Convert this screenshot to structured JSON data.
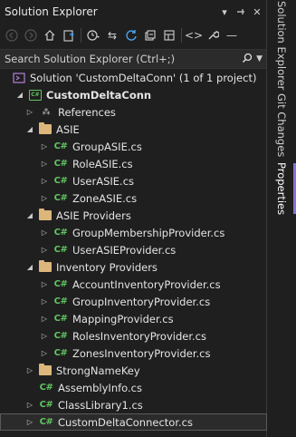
{
  "panel": {
    "title": "Solution Explorer",
    "title_buttons": [
      "dropdown-icon",
      "pin-icon",
      "close-icon"
    ]
  },
  "toolbar": {
    "icons": [
      "back-icon",
      "forward-icon",
      "home-icon",
      "sync-active-doc-icon",
      "history-icon",
      "switch-views-icon",
      "refresh-icon",
      "collapse-all-icon",
      "show-all-files-icon",
      "preview-icon",
      "properties-icon"
    ]
  },
  "search": {
    "placeholder": "Search Solution Explorer (Ctrl+;)"
  },
  "tree": {
    "solution": "Solution 'CustomDeltaConn' (1 of 1 project)",
    "project": "CustomDeltaConn",
    "references": "References",
    "asie": {
      "label": "ASIE",
      "files": [
        "GroupASIE.cs",
        "RoleASIE.cs",
        "UserASIE.cs",
        "ZoneASIE.cs"
      ]
    },
    "asie_providers": {
      "label": "ASIE Providers",
      "files": [
        "GroupMembershipProvider.cs",
        "UserASIEProvider.cs"
      ]
    },
    "inventory_providers": {
      "label": "Inventory Providers",
      "files": [
        "AccountInventoryProvider.cs",
        "GroupInventoryProvider.cs",
        "MappingProvider.cs",
        "RolesInventoryProvider.cs",
        "ZonesInventoryProvider.cs"
      ]
    },
    "strongnamekey": "StrongNameKey",
    "assemblyinfo": "AssemblyInfo.cs",
    "classlibrary": "ClassLibrary1.cs",
    "connector": "CustomDeltaConnector.cs",
    "cs_badge": "C#"
  },
  "side_tabs": {
    "solution_explorer": "Solution Explorer",
    "git_changes": "Git Changes",
    "properties": "Properties"
  },
  "colors": {
    "accent": "#8a6fd6",
    "csharp": "#62c462",
    "folder": "#dcb67a"
  }
}
